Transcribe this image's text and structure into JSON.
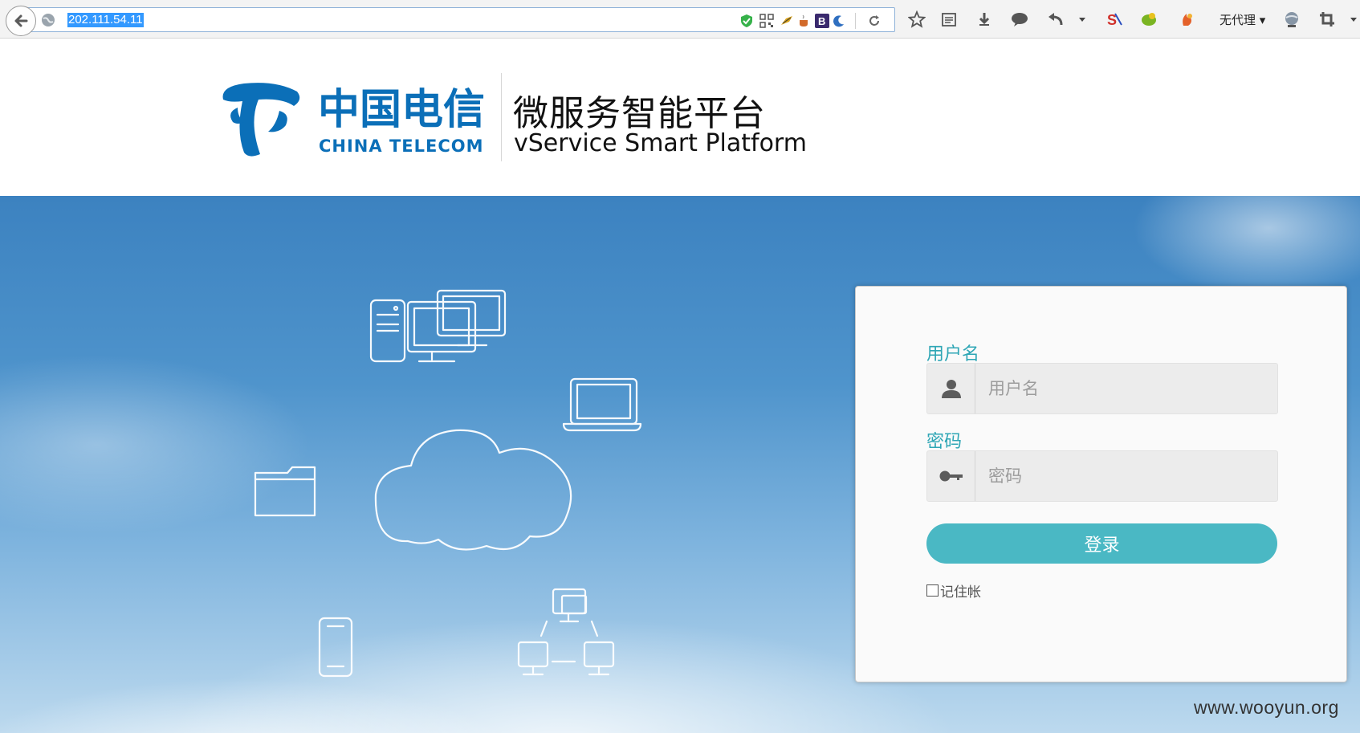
{
  "browser": {
    "url": "202.111.54.11",
    "proxy_label": "无代理",
    "toolbar_icons": [
      "back-icon",
      "globe-icon",
      "shield-check-icon",
      "qr-code-icon",
      "reload-icon",
      "star-icon",
      "reading-list-icon",
      "download-icon",
      "chat-icon",
      "undo-icon",
      "dropdown-icon",
      "proxy-icon",
      "crop-icon"
    ]
  },
  "header": {
    "logo_cn": "中国电信",
    "logo_en": "CHINA TELECOM",
    "platform_cn": "微服务智能平台",
    "platform_en": "vService Smart Platform",
    "brand_color": "#0b6fb8"
  },
  "login": {
    "username_label": "用户名",
    "username_placeholder": "用户名",
    "password_label": "密码",
    "password_placeholder": "密码",
    "submit_label": "登录",
    "remember_label": "记住帐",
    "remember_checked": false,
    "accent_color": "#4ab8c4"
  },
  "watermark": "www.wooyun.org"
}
